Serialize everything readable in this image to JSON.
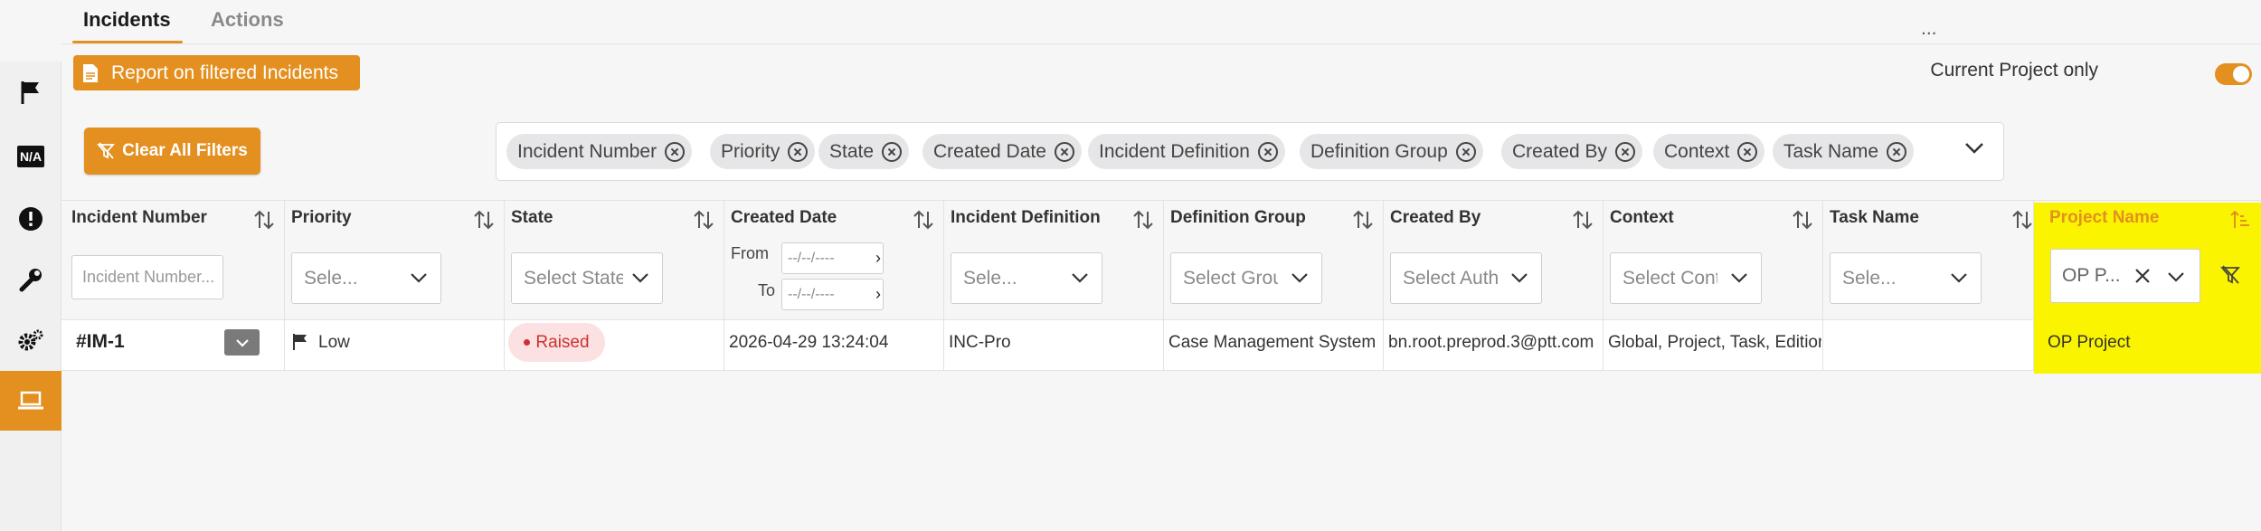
{
  "tabs": [
    {
      "label": "Incidents",
      "active": true
    },
    {
      "label": "Actions",
      "active": false
    }
  ],
  "rail": {
    "items": [
      "flag-icon",
      "na-icon",
      "alert-icon",
      "wrench-icon",
      "gears-icon",
      "laptop-icon"
    ],
    "active": "laptop-icon",
    "na_text": "N/A"
  },
  "report_button": "Report on filtered Incidents",
  "current_project": {
    "label": "Current Project only",
    "enabled": true
  },
  "clear_filters": "Clear All Filters",
  "filter_chips": [
    "Incident Number",
    "Priority",
    "State",
    "Created Date",
    "Incident Definition",
    "Definition Group",
    "Created By",
    "Context",
    "Task Name"
  ],
  "chips_more": "...",
  "columns": [
    "Incident Number",
    "Priority",
    "State",
    "Created Date",
    "Incident Definition",
    "Definition Group",
    "Created By",
    "Context",
    "Task Name",
    "Project Name"
  ],
  "filters": {
    "incident_number_placeholder": "Incident Number...",
    "priority": "Sele...",
    "state": "Select State",
    "date_from_label": "From",
    "date_to_label": "To",
    "date_placeholder": "--/--/----",
    "incident_definition": "Sele...",
    "definition_group": "Select Group",
    "created_by": "Select Author",
    "context": "Select Context",
    "task_name": "Sele...",
    "project_name": "OP P..."
  },
  "row": {
    "id": "#IM-1",
    "priority": "Low",
    "state": "Raised",
    "created_date": "2026-04-29 13:24:04",
    "incident_definition": "INC-Pro",
    "definition_group": "Case Management System",
    "created_by": "bn.root.preprod.3@ptt.com",
    "context": "Global, Project, Task, Edition",
    "task_name": "",
    "project_name": "OP Project"
  },
  "colors": {
    "accent": "#e39020",
    "highlight": "#fbf400",
    "raised": "#d03030"
  }
}
